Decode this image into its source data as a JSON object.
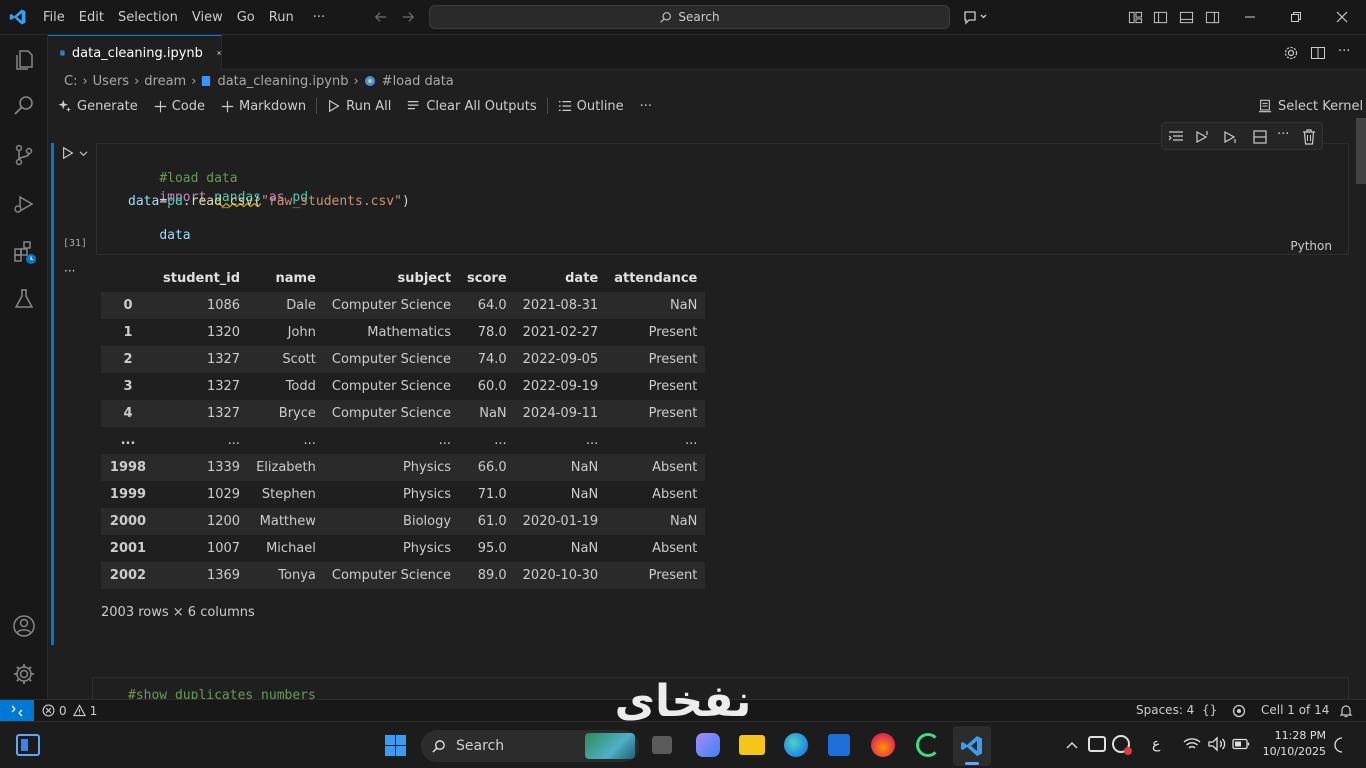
{
  "menu": [
    "File",
    "Edit",
    "Selection",
    "View",
    "Go",
    "Run",
    "···"
  ],
  "search": {
    "label": "Search"
  },
  "tab": {
    "label": "data_cleaning.ipynb"
  },
  "breadcrumb": {
    "items": [
      "C:",
      "Users",
      "dream",
      "data_cleaning.ipynb",
      "#load data"
    ]
  },
  "toolbar": {
    "generate": "Generate",
    "code": "Code",
    "markdown": "Markdown",
    "run_all": "Run All",
    "clear_outputs": "Clear All Outputs",
    "outline": "Outline",
    "more": "···",
    "select_kernel": "Select Kernel"
  },
  "cell": {
    "exec_count": "[31]",
    "language": "Python",
    "code": {
      "line1_comment": "#load data",
      "line2_kw": "import",
      "line2_mod": "pandas",
      "line2_as": "as",
      "line2_alias": "pd",
      "line3_var": "data",
      "line3_eq": "=",
      "line3_obj": "pd",
      "line3_dot": ".",
      "line3_fn": "read_csv",
      "line3_open": "(",
      "line3_str": "\"raw_students.csv\"",
      "line3_close": ")",
      "line4": "data"
    },
    "output_more": "···"
  },
  "dataframe": {
    "columns": [
      "",
      "student_id",
      "name",
      "subject",
      "score",
      "date",
      "attendance"
    ],
    "rows": [
      [
        "0",
        "1086",
        "Dale",
        "Computer Science",
        "64.0",
        "2021-08-31",
        "NaN"
      ],
      [
        "1",
        "1320",
        "John",
        "Mathematics",
        "78.0",
        "2021-02-27",
        "Present"
      ],
      [
        "2",
        "1327",
        "Scott",
        "Computer Science",
        "74.0",
        "2022-09-05",
        "Present"
      ],
      [
        "3",
        "1327",
        "Todd",
        "Computer Science",
        "60.0",
        "2022-09-19",
        "Present"
      ],
      [
        "4",
        "1327",
        "Bryce",
        "Computer Science",
        "NaN",
        "2024-09-11",
        "Present"
      ],
      [
        "...",
        "...",
        "...",
        "...",
        "...",
        "...",
        "..."
      ],
      [
        "1998",
        "1339",
        "Elizabeth",
        "Physics",
        "66.0",
        "NaN",
        "Absent"
      ],
      [
        "1999",
        "1029",
        "Stephen",
        "Physics",
        "71.0",
        "NaN",
        "Absent"
      ],
      [
        "2000",
        "1200",
        "Matthew",
        "Biology",
        "61.0",
        "2020-01-19",
        "NaN"
      ],
      [
        "2001",
        "1007",
        "Michael",
        "Physics",
        "95.0",
        "NaN",
        "Absent"
      ],
      [
        "2002",
        "1369",
        "Tonya",
        "Computer Science",
        "89.0",
        "2020-10-30",
        "Present"
      ]
    ],
    "shape": "2003 rows × 6 columns"
  },
  "next_cell": {
    "code": "#show duplicates numbers"
  },
  "statusbar": {
    "errors": "0",
    "warnings": "1",
    "spaces": "Spaces: 4",
    "braces": "{}",
    "cell": "Cell 1 of 14"
  },
  "taskbar": {
    "search": "Search",
    "time": "11:28 PM",
    "date": "10/10/2025",
    "lang": "ع"
  },
  "watermark": "نفخاي",
  "colors": {
    "accent": "#0078d4",
    "comment": "#6a9955",
    "keyword": "#c586c0",
    "module": "#4ec9b0",
    "variable": "#9cdcfe",
    "function": "#dcdcaa",
    "string": "#ce9178"
  }
}
